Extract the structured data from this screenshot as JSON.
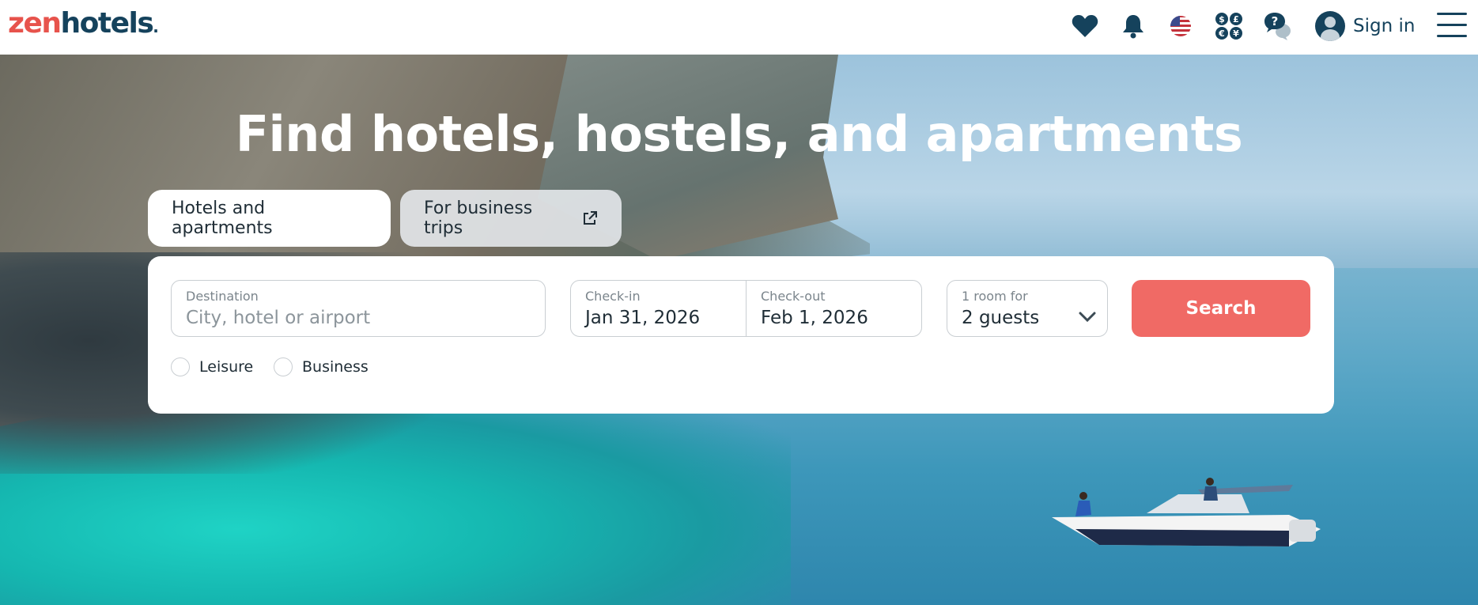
{
  "header": {
    "logo": {
      "part1": "zen",
      "part2": "hotels",
      "suffix": "."
    },
    "icons": [
      "heart-icon",
      "bell-icon",
      "us-flag-icon",
      "currency-icon",
      "help-chat-icon"
    ],
    "sign_in_label": "Sign in",
    "menu_icon": "menu-icon"
  },
  "hero": {
    "title": "Find hotels, hostels, and apartments"
  },
  "tabs": [
    {
      "label": "Hotels and apartments",
      "active": true
    },
    {
      "label": "For business trips",
      "active": false,
      "icon": "external-link-icon"
    }
  ],
  "search": {
    "destination": {
      "label": "Destination",
      "placeholder": "City, hotel or airport"
    },
    "checkin": {
      "label": "Check-in",
      "value": "Jan 31, 2026"
    },
    "checkout": {
      "label": "Check-out",
      "value": "Feb 1, 2026"
    },
    "guests": {
      "label": "1 room for",
      "value": "2 guests"
    },
    "button_label": "Search",
    "purpose": [
      {
        "label": "Leisure",
        "selected": false
      },
      {
        "label": "Business",
        "selected": false
      }
    ]
  },
  "colors": {
    "brand_red": "#e7534c",
    "brand_navy": "#15425c",
    "search_button": "#f06a65"
  }
}
